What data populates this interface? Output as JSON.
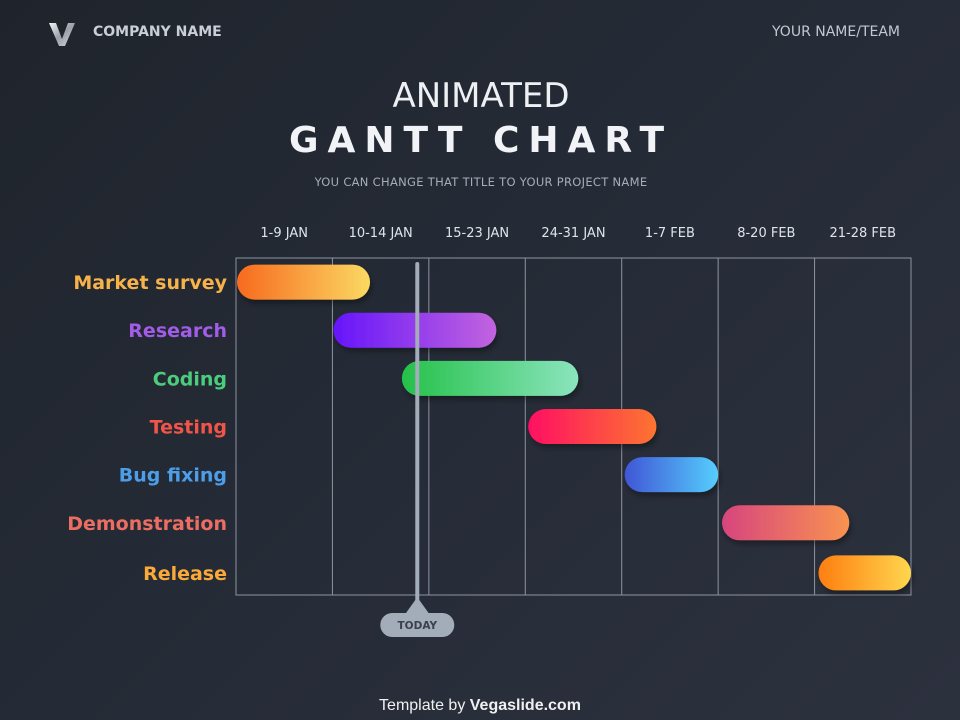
{
  "header": {
    "logo_icon": "v-logo-icon",
    "company_name": "COMPANY NAME",
    "team_name": "YOUR NAME/TEAM"
  },
  "title": {
    "line1": "ANIMATED",
    "line2": "GANTT CHART",
    "subtitle": "YOU CAN CHANGE THAT TITLE TO YOUR PROJECT NAME"
  },
  "chart_data": {
    "type": "gantt",
    "title": "GANTT CHART",
    "periods": [
      "1-9 JAN",
      "10-14 JAN",
      "15-23 JAN",
      "24-31 JAN",
      "1-7 FEB",
      "8-20 FEB",
      "21-28 FEB"
    ],
    "x_unit": "period index (0 = start of 1-9 JAN, 7 = end of 21-28 FEB)",
    "xlim": [
      0,
      7
    ],
    "grid": true,
    "tasks": [
      {
        "name": "Market survey",
        "start": 0.0,
        "end": 1.39,
        "label_color": "#f7b24a",
        "colors": [
          "#f76a1f",
          "#fbd962"
        ]
      },
      {
        "name": "Research",
        "start": 1.0,
        "end": 2.7,
        "label_color": "#a15ce8",
        "colors": [
          "#6615fb",
          "#c264de"
        ]
      },
      {
        "name": "Coding",
        "start": 1.71,
        "end": 3.55,
        "label_color": "#4ccd7d",
        "colors": [
          "#25c14a",
          "#8be4bd"
        ]
      },
      {
        "name": "Testing",
        "start": 3.02,
        "end": 4.36,
        "label_color": "#f15448",
        "colors": [
          "#fe0f62",
          "#fd7530"
        ]
      },
      {
        "name": "Bug fixing",
        "start": 4.02,
        "end": 5.0,
        "label_color": "#4c9ee9",
        "colors": [
          "#4056d6",
          "#55cefc"
        ]
      },
      {
        "name": "Demonstration",
        "start": 5.03,
        "end": 6.36,
        "label_color": "#ec6e63",
        "colors": [
          "#d7457d",
          "#f89350"
        ]
      },
      {
        "name": "Release",
        "start": 6.03,
        "end": 7.0,
        "label_color": "#fba938",
        "colors": [
          "#fe7e10",
          "#ffd64e"
        ]
      }
    ],
    "today": {
      "label": "TODAY",
      "position": 1.88
    }
  },
  "footer": {
    "prefix": "Template by",
    "brand": "Vegaslide.com"
  }
}
